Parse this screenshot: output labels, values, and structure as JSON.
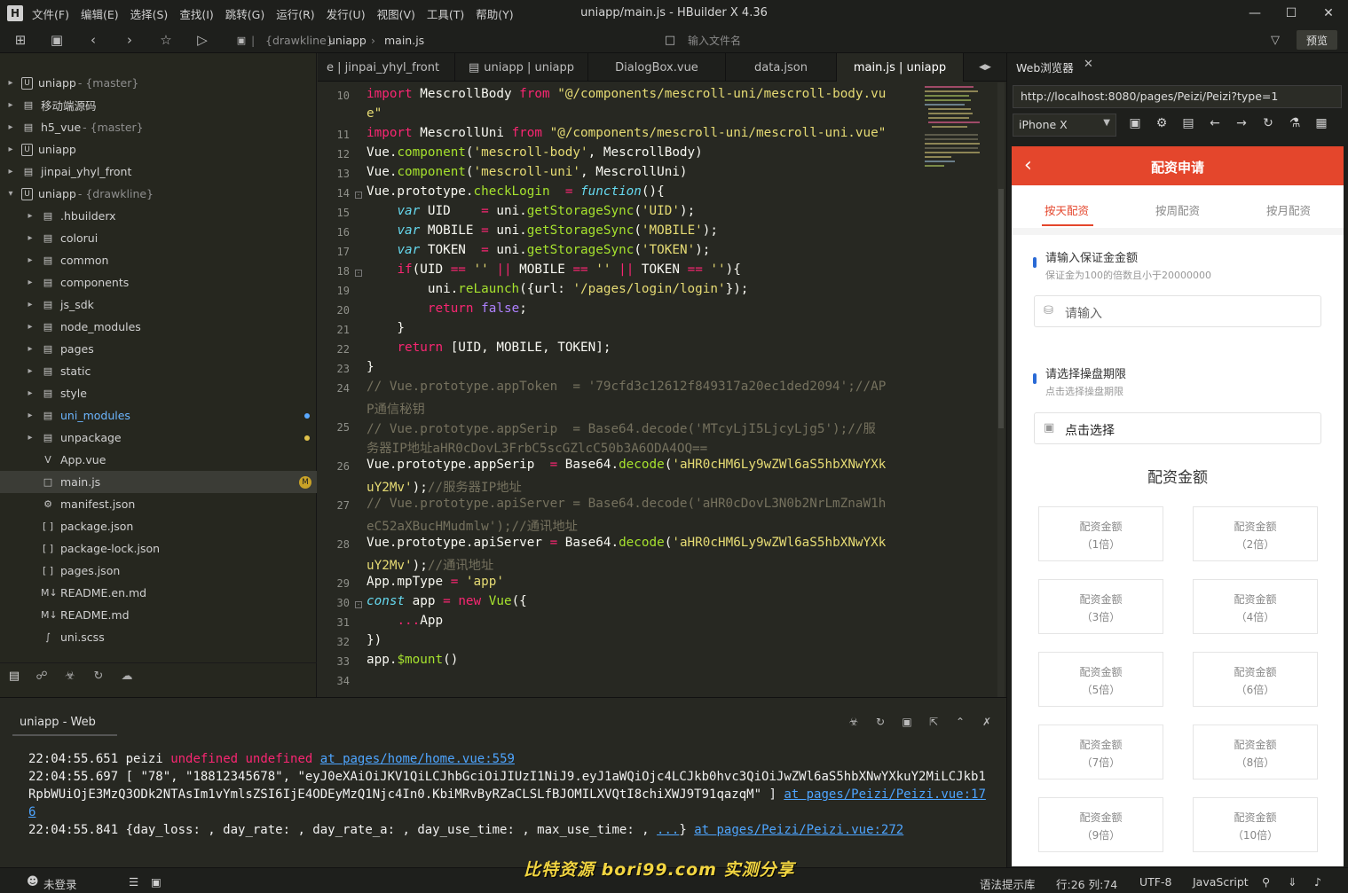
{
  "app": {
    "title": "uniapp/main.js - HBuilder X 4.36",
    "menu": [
      "文件(F)",
      "编辑(E)",
      "选择(S)",
      "查找(I)",
      "跳转(G)",
      "运行(R)",
      "发行(U)",
      "视图(V)",
      "工具(T)",
      "帮助(Y)"
    ]
  },
  "toolbar": {
    "breadcrumb_project": "{drawkline}",
    "breadcrumb_root": "uniapp",
    "breadcrumb_file": "main.js",
    "search_placeholder": "输入文件名",
    "preview_label": "预览"
  },
  "sidebar": {
    "items": [
      {
        "label": "uniapp",
        "sub": "- {master}",
        "icon": "project-icon"
      },
      {
        "label": "移动端源码",
        "sub": "",
        "icon": "folder-icon"
      },
      {
        "label": "h5_vue",
        "sub": "- {master}",
        "icon": "project-icon"
      },
      {
        "label": "uniapp",
        "sub": "",
        "icon": "project-icon"
      },
      {
        "label": "jinpai_yhyl_front",
        "sub": "",
        "icon": "folder-icon"
      },
      {
        "label": "uniapp",
        "sub": "- {drawkline}",
        "icon": "project-icon"
      },
      {
        "label": ".hbuilderx",
        "sub": "",
        "icon": "folder-icon"
      },
      {
        "label": "colorui",
        "sub": "",
        "icon": "folder-icon"
      },
      {
        "label": "common",
        "sub": "",
        "icon": "folder-icon"
      },
      {
        "label": "components",
        "sub": "",
        "icon": "folder-icon"
      },
      {
        "label": "js_sdk",
        "sub": "",
        "icon": "folder-icon"
      },
      {
        "label": "node_modules",
        "sub": "",
        "icon": "folder-icon"
      },
      {
        "label": "pages",
        "sub": "",
        "icon": "folder-icon"
      },
      {
        "label": "static",
        "sub": "",
        "icon": "folder-icon"
      },
      {
        "label": "style",
        "sub": "",
        "icon": "folder-icon"
      },
      {
        "label": "uni_modules",
        "sub": "",
        "icon": "folder-icon"
      },
      {
        "label": "unpackage",
        "sub": "",
        "icon": "folder-icon"
      },
      {
        "label": "App.vue",
        "sub": "",
        "icon": "vue-file-icon"
      },
      {
        "label": "main.js",
        "sub": "",
        "icon": "js-file-icon"
      },
      {
        "label": "manifest.json",
        "sub": "",
        "icon": "settings-file-icon"
      },
      {
        "label": "package.json",
        "sub": "",
        "icon": "json-file-icon"
      },
      {
        "label": "package-lock.json",
        "sub": "",
        "icon": "json-file-icon"
      },
      {
        "label": "pages.json",
        "sub": "",
        "icon": "json-file-icon"
      },
      {
        "label": "README.en.md",
        "sub": "",
        "icon": "markdown-file-icon"
      },
      {
        "label": "README.md",
        "sub": "",
        "icon": "markdown-file-icon"
      },
      {
        "label": "uni.scss",
        "sub": "",
        "icon": "scss-file-icon"
      }
    ],
    "modified_badge": "M"
  },
  "tabs": [
    "e | jinpai_yhyl_front",
    "uniapp | uniapp",
    "DialogBox.vue",
    "data.json",
    "main.js | uniapp"
  ],
  "editor": {
    "line_numbers": [
      "10",
      "11",
      "12",
      "13",
      "14",
      "15",
      "16",
      "17",
      "18",
      "19",
      "20",
      "21",
      "22",
      "23",
      "24",
      "25",
      "26",
      "27",
      "28",
      "29",
      "30",
      "31",
      "32",
      "33",
      "34"
    ]
  },
  "console": {
    "tab_label": "uniapp - Web",
    "log1": {
      "time": "22:04:55.651",
      "text": "peizi",
      "u1": "undefined",
      "u2": "undefined",
      "link": "at pages/home/home.vue:559"
    },
    "log2": {
      "time": "22:04:55.697",
      "text": "[ \"78\", \"18812345678\", \"eyJ0eXAiOiJKV1QiLCJhbGciOiJIUzI1NiJ9.eyJ1aWQiOjc4LCJkb0hvc3QiOiJwZWl6aS5hbXNwYXkuY2MiLCJkb1RpbWUiOjE3MzQ3ODk2NTAsIm1vYmlsZSI6IjE4ODEyMzQ1Njc4In0.KbiMRvByRZaCLSLfBJOMILXVQtI8chiXWJ9T91qazqM\" ]",
      "link": "at pages/Peizi/Peizi.vue:176"
    },
    "log3": {
      "time": "22:04:55.841",
      "text": "{day_loss: , day_rate: , day_rate_a: , day_use_time: , max_use_time: ,",
      "ellipsis": "...",
      "close": "}",
      "link": "at pages/Peizi/Peizi.vue:272"
    }
  },
  "browser": {
    "tab_label": "Web浏览器",
    "url": "http://localhost:8080/pages/Peizi/Peizi?type=1",
    "device": "iPhone X"
  },
  "phone": {
    "title": "配资申请",
    "tabs": [
      "按天配资",
      "按周配资",
      "按月配资"
    ],
    "deposit_label": "请输入保证金金额",
    "deposit_hint": "保证金为100的倍数且小于20000000",
    "deposit_placeholder": "请输入",
    "period_label": "请选择操盘期限",
    "period_hint": "点击选择操盘期限",
    "period_value": "点击选择",
    "amount_title": "配资金额",
    "cards": [
      {
        "l1": "配资金额",
        "l2": "（1倍）"
      },
      {
        "l1": "配资金额",
        "l2": "（2倍）"
      },
      {
        "l1": "配资金额",
        "l2": "（3倍）"
      },
      {
        "l1": "配资金额",
        "l2": "（4倍）"
      },
      {
        "l1": "配资金额",
        "l2": "（5倍）"
      },
      {
        "l1": "配资金额",
        "l2": "（6倍）"
      },
      {
        "l1": "配资金额",
        "l2": "（7倍）"
      },
      {
        "l1": "配资金额",
        "l2": "（8倍）"
      },
      {
        "l1": "配资金额",
        "l2": "（9倍）"
      },
      {
        "l1": "配资金额",
        "l2": "（10倍）"
      }
    ]
  },
  "statusbar": {
    "login": "未登录",
    "syntax": "语法提示库",
    "position": "行:26  列:74",
    "encoding": "UTF-8",
    "language": "JavaScript",
    "watermark": "比特资源 bori99.com 实测分享"
  }
}
